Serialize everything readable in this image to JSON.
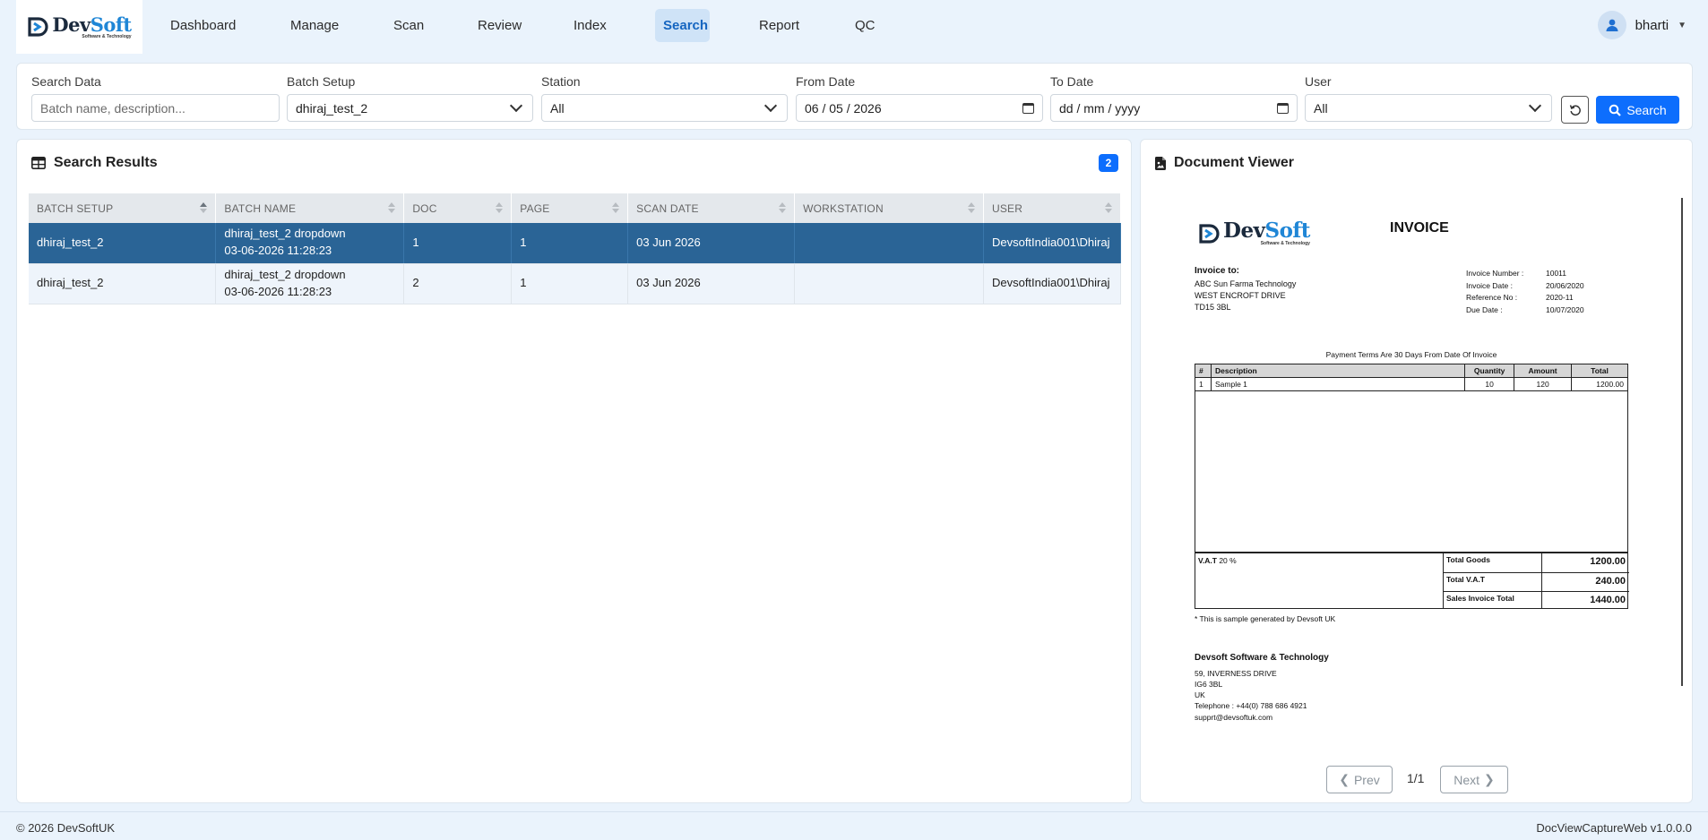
{
  "brand": {
    "name_a": "Dev",
    "name_b": "Soft",
    "tagline": "Software & Technology"
  },
  "nav": {
    "items": [
      {
        "label": "Dashboard"
      },
      {
        "label": "Manage"
      },
      {
        "label": "Scan"
      },
      {
        "label": "Review"
      },
      {
        "label": "Index"
      },
      {
        "label": "Search"
      },
      {
        "label": "Report"
      },
      {
        "label": "QC"
      }
    ],
    "active": "Search",
    "user": "bharti"
  },
  "filters": {
    "search_data": {
      "label": "Search Data",
      "placeholder": "Batch name, description..."
    },
    "batch_setup": {
      "label": "Batch Setup",
      "value": "dhiraj_test_2"
    },
    "station": {
      "label": "Station",
      "value": "All"
    },
    "from_date": {
      "label": "From Date",
      "value": "06 / 05 / 2026"
    },
    "to_date": {
      "label": "To Date",
      "value": "dd / mm / yyyy"
    },
    "user": {
      "label": "User",
      "value": "All"
    },
    "search_button": "Search"
  },
  "results": {
    "title": "Search Results",
    "count": "2",
    "columns": [
      "BATCH SETUP",
      "BATCH NAME",
      "DOC",
      "PAGE",
      "SCAN DATE",
      "WORKSTATION",
      "USER"
    ],
    "rows": [
      {
        "batch_setup": "dhiraj_test_2",
        "batch_name_1": "dhiraj_test_2 dropdown",
        "batch_name_2": "03-06-2026 11:28:23",
        "doc": "1",
        "page": "1",
        "scan_date": "03 Jun 2026",
        "workstation": "",
        "user": "DevsoftIndia001\\Dhiraj"
      },
      {
        "batch_setup": "dhiraj_test_2",
        "batch_name_1": "dhiraj_test_2 dropdown",
        "batch_name_2": "03-06-2026 11:28:23",
        "doc": "2",
        "page": "1",
        "scan_date": "03 Jun 2026",
        "workstation": "",
        "user": "DevsoftIndia001\\Dhiraj"
      }
    ]
  },
  "viewer": {
    "title": "Document Viewer",
    "prev": "Prev",
    "next": "Next",
    "page_indicator": "1/1",
    "invoice": {
      "heading": "INVOICE",
      "to_label": "Invoice to:",
      "to_lines": [
        "ABC Sun Farma Technology",
        "WEST ENCROFT DRIVE",
        "TD15 3BL"
      ],
      "meta": [
        {
          "k": "Invoice Number :",
          "v": "10011"
        },
        {
          "k": "Invoice Date :",
          "v": "20/06/2020"
        },
        {
          "k": "Reference No :",
          "v": "2020-11"
        },
        {
          "k": "Due Date :",
          "v": "10/07/2020"
        }
      ],
      "terms": "Payment Terms Are 30 Days From Date Of Invoice",
      "columns": [
        "#",
        "Description",
        "Quantity",
        "Amount",
        "Total"
      ],
      "line": {
        "n": "1",
        "desc": "Sample 1",
        "qty": "10",
        "amount": "120",
        "total": "1200.00"
      },
      "vat_label": "V.A.T",
      "vat_rate": "20 %",
      "totals": [
        {
          "k": "Total Goods",
          "v": "1200.00"
        },
        {
          "k": "Total V.A.T",
          "v": "240.00"
        },
        {
          "k": "Sales Invoice Total",
          "v": "1440.00"
        }
      ],
      "note": "* This is sample generated by Devsoft UK",
      "company": "Devsoft Software & Technology",
      "addr": [
        "59, INVERNESS DRIVE",
        "IG6 3BL",
        "UK",
        "Telephone : +44(0) 788 686 4921",
        "supprt@devsoftuk.com"
      ]
    }
  },
  "footer": {
    "copyright": "© 2026 DevSoftUK",
    "version": "DocViewCaptureWeb v1.0.0.0"
  }
}
